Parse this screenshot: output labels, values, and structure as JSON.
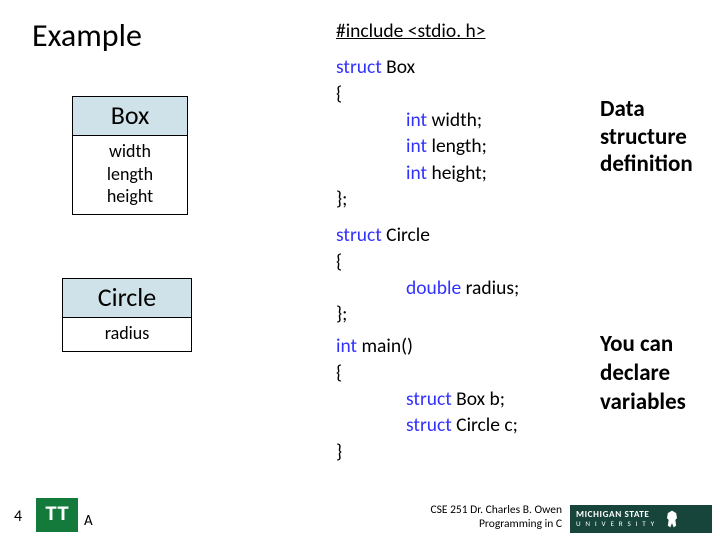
{
  "title": "Example",
  "uml": {
    "box": {
      "name": "Box",
      "attrs": [
        "width",
        "length",
        "height"
      ]
    },
    "circle": {
      "name": "Circle",
      "attrs": [
        "radius"
      ]
    }
  },
  "code": {
    "include": "#include <stdio. h>",
    "struct_box": {
      "kw": "struct ",
      "name": "Box",
      "open": "{",
      "m1_t": "int ",
      "m1": "width;",
      "m2_t": "int ",
      "m2": "length;",
      "m3_t": "int ",
      "m3": "height;",
      "close": "};"
    },
    "struct_circle": {
      "kw": "struct ",
      "name": "Circle",
      "open": "{",
      "m1_t": "double ",
      "m1": "radius;",
      "close": "};"
    },
    "main": {
      "kw": "int ",
      "name": "main()",
      "open": "{",
      "v1_kw": "struct ",
      "v1": "Box b;",
      "v2_kw": "struct ",
      "v2": "Circle c;",
      "close": "}"
    }
  },
  "notes": {
    "n1a": "Data",
    "n1b": "structure",
    "n1c": "definition",
    "n2a": "You can",
    "n2b": "declare",
    "n2c": "variables"
  },
  "footer": {
    "page": "4",
    "tt": "TT",
    "tt_sub": "A",
    "credit1": "CSE 251 Dr. Charles B. Owen",
    "credit2": "Programming in C",
    "msu1": "MICHIGAN STATE",
    "msu2": "U N I V E R S I T Y"
  }
}
